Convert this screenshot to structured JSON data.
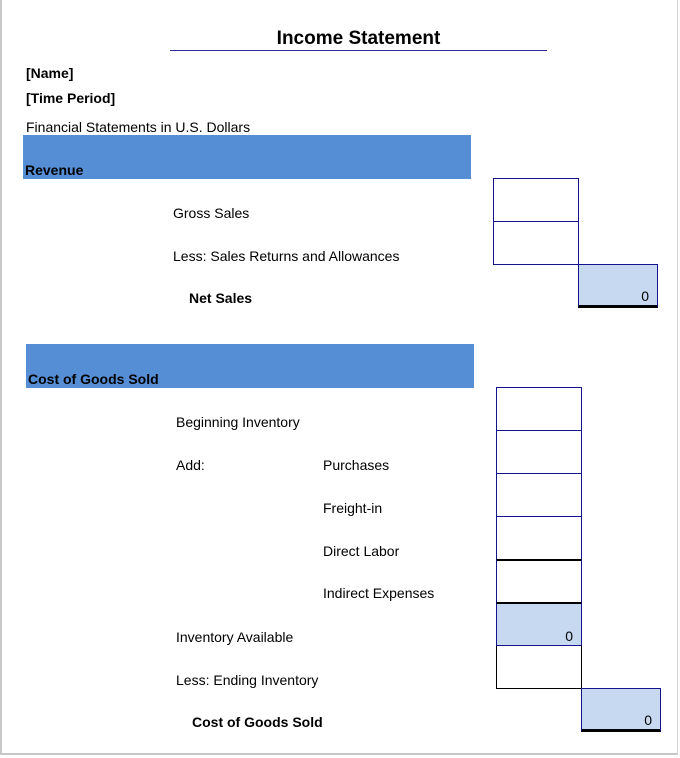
{
  "document": {
    "title": "Income Statement",
    "name_placeholder": "[Name]",
    "period_placeholder": "[Time Period]",
    "currency_note": "Financial Statements in U.S. Dollars",
    "colors": {
      "section_band": "#558ed5",
      "total_cell": "#c6d9f1",
      "cell_border": "#14148c"
    }
  },
  "revenue": {
    "header": "Revenue",
    "gross_sales": {
      "label": "Gross Sales",
      "value": ""
    },
    "returns": {
      "label": "Less: Sales Returns and Allowances",
      "value": ""
    },
    "net_sales": {
      "label": "Net Sales",
      "value": "0"
    }
  },
  "cogs": {
    "header": "Cost of Goods Sold",
    "beginning_inventory": {
      "label": "Beginning Inventory",
      "value": ""
    },
    "add_label": "Add:",
    "purchases": {
      "label": "Purchases",
      "value": ""
    },
    "freight_in": {
      "label": "Freight-in",
      "value": ""
    },
    "direct_labor": {
      "label": "Direct Labor",
      "value": ""
    },
    "indirect_expenses": {
      "label": "Indirect Expenses",
      "value": ""
    },
    "inventory_available": {
      "label": "Inventory Available",
      "value": "0"
    },
    "ending_inventory": {
      "label": "Less: Ending Inventory",
      "value": ""
    },
    "total": {
      "label": "Cost of Goods Sold",
      "value": "0"
    }
  }
}
